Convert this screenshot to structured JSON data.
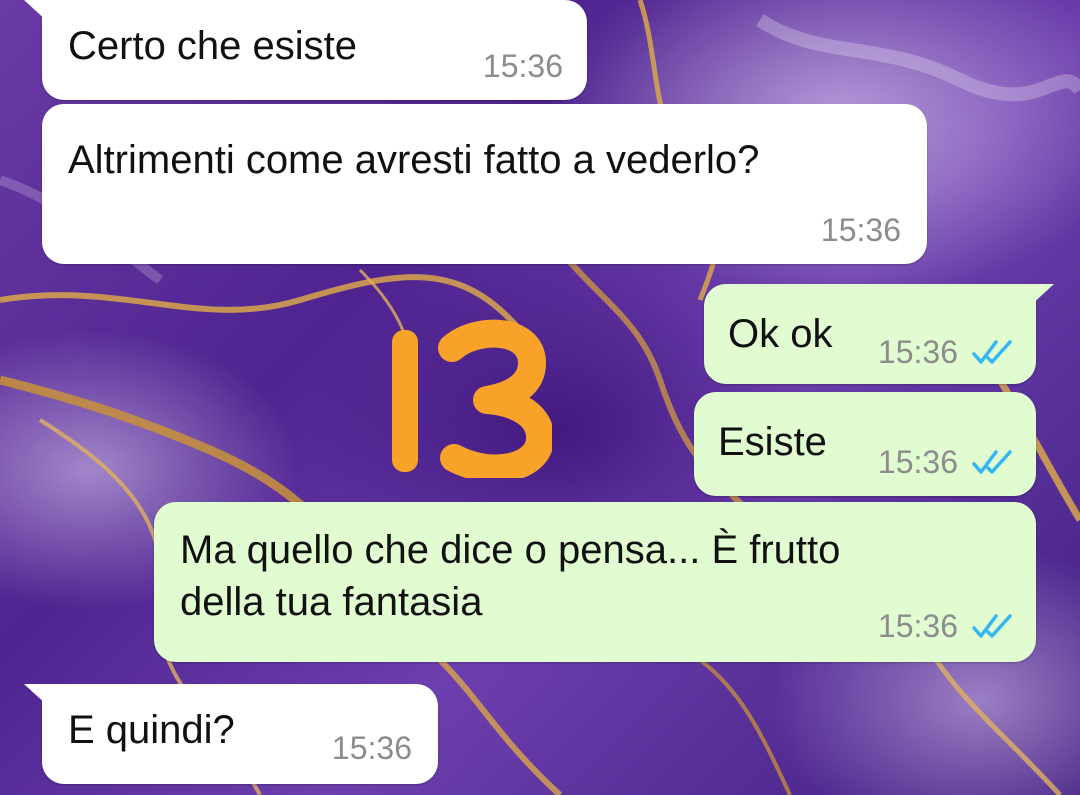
{
  "colors": {
    "incoming_bubble": "#ffffff",
    "outgoing_bubble": "#e2fcd2",
    "timestamp": "#8c8c8c",
    "read_receipt": "#34b7f1",
    "sticker": "#f8a22a",
    "wallpaper_accent": "#d9a64a"
  },
  "sticker": {
    "text": "13"
  },
  "messages": [
    {
      "direction": "incoming",
      "text": "Certo che esiste",
      "time": "15:36"
    },
    {
      "direction": "incoming",
      "text": "Altrimenti come avresti fatto a vederlo?",
      "time": "15:36"
    },
    {
      "direction": "outgoing",
      "text": "Ok ok",
      "time": "15:36",
      "status": "read-double-check-icon"
    },
    {
      "direction": "outgoing",
      "text": "Esiste",
      "time": "15:36",
      "status": "read-double-check-icon"
    },
    {
      "direction": "outgoing",
      "text": "Ma quello che dice o pensa... È frutto\ndella tua fantasia",
      "time": "15:36",
      "status": "read-double-check-icon"
    },
    {
      "direction": "incoming",
      "text": "E quindi?",
      "time": "15:36"
    }
  ]
}
